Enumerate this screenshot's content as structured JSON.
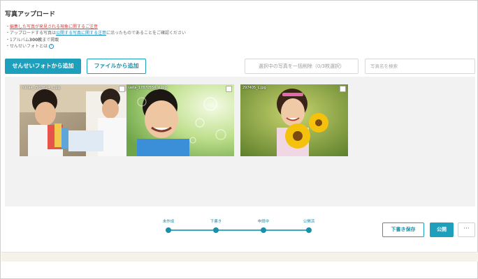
{
  "page": {
    "title": "写真アップロード"
  },
  "notes": {
    "line1_prefix": "・",
    "line1_link": "編集した写真が発見される現象に関するご注意",
    "line2_a": "・アップロードする写真は",
    "line2_link": "公開する写真に関する注意",
    "line2_b": "に沿ったものであることをご確認ください",
    "line3_a": "・1アルバム",
    "line3_bold": "300枚",
    "line3_b": "まで掲載",
    "line4": "・せんせいフォトとは",
    "help_glyph": "?"
  },
  "toolbar": {
    "add_sensei_label": "せんせいフォトから追加",
    "add_file_label": "ファイルから追加",
    "bulk_delete_label": "選択中の写真を一括削除（0/3枚選択）",
    "search_placeholder": "写真名を検索"
  },
  "photos": [
    {
      "filename": "minae_2911824_L.jpg"
    },
    {
      "filename": "ueta_1787055R_R.jpg"
    },
    {
      "filename": "297405_L.jpg"
    }
  ],
  "steps": [
    {
      "label": "未作成"
    },
    {
      "label": "下書き"
    },
    {
      "label": "申請中"
    },
    {
      "label": "公開済"
    }
  ],
  "actions": {
    "draft_label": "下書き保存",
    "publish_label": "公開",
    "more_label": "···"
  },
  "colors": {
    "accent": "#1ea0bd",
    "link_red": "#e0403a",
    "link_blue": "#1a8fc2"
  }
}
